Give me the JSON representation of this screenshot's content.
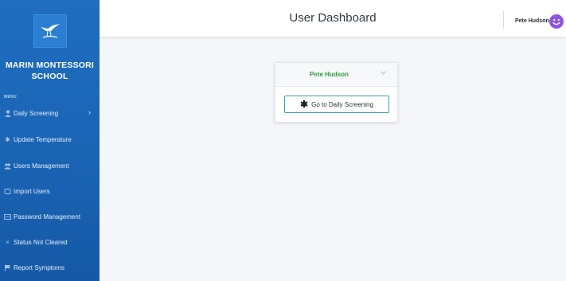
{
  "brand": {
    "school_name": "MARIN MONTESSORI SCHOOL"
  },
  "sidebar": {
    "menu_heading": "MENU",
    "items": [
      {
        "label": "Daily Screening",
        "icon": "user-icon"
      },
      {
        "label": "Update Temperature",
        "icon": "asterisk-icon"
      },
      {
        "label": "Users Management",
        "icon": "users-icon"
      },
      {
        "label": "Import Users",
        "icon": "import-icon"
      },
      {
        "label": "Password Management",
        "icon": "keyboard-icon"
      },
      {
        "label": "Status Not Cleared",
        "icon": "x-icon"
      },
      {
        "label": "Report Symptoms",
        "icon": "flag-icon"
      }
    ]
  },
  "header": {
    "title": "User Dashboard",
    "user_name": "Pete Hudson"
  },
  "card": {
    "name": "Pete Hudson",
    "button_label": "Go to Daily Screening"
  },
  "colors": {
    "sidebar": "#1f6ec0",
    "accent_green": "#2e9b3c",
    "button_border": "#39a2ae",
    "avatar": "#8d55e0"
  }
}
